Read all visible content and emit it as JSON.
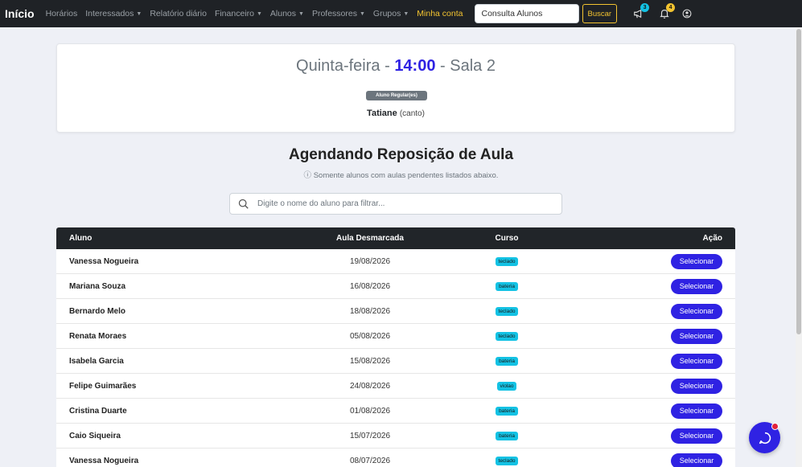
{
  "nav": {
    "brand": "Início",
    "items": [
      {
        "label": "Horários",
        "caret": false
      },
      {
        "label": "Interessados",
        "caret": true
      },
      {
        "label": "Relatório diário",
        "caret": false
      },
      {
        "label": "Financeiro",
        "caret": true
      },
      {
        "label": "Alunos",
        "caret": true
      },
      {
        "label": "Professores",
        "caret": true
      },
      {
        "label": "Grupos",
        "caret": true
      },
      {
        "label": "Minha conta",
        "caret": false,
        "active": true
      }
    ],
    "search_value": "Consulta Alunos",
    "search_button": "Buscar",
    "megaphone_count": "3",
    "bell_count": "4"
  },
  "class_info": {
    "day": "Quinta-feira",
    "sep1": " - ",
    "time": "14:00",
    "sep2": " - ",
    "room": "Sala 2",
    "badge": "Aluno Regular(es)",
    "student": "Tatiane",
    "student_note": "(canto)"
  },
  "page": {
    "heading": "Agendando Reposição de Aula",
    "note": "Somente alunos com aulas pendentes listados abaixo.",
    "filter_placeholder": "Digite o nome do aluno para filtrar..."
  },
  "table": {
    "headers": [
      "Aluno",
      "Aula Desmarcada",
      "Curso",
      "Ação"
    ],
    "rows": [
      {
        "aluno": "Vanessa Nogueira",
        "data": "19/08/2026",
        "curso": "teclado",
        "acao": "Selecionar"
      },
      {
        "aluno": "Mariana Souza",
        "data": "16/08/2026",
        "curso": "bateria",
        "acao": "Selecionar"
      },
      {
        "aluno": "Bernardo Melo",
        "data": "18/08/2026",
        "curso": "teclado",
        "acao": "Selecionar"
      },
      {
        "aluno": "Renata Moraes",
        "data": "05/08/2026",
        "curso": "teclado",
        "acao": "Selecionar"
      },
      {
        "aluno": "Isabela Garcia",
        "data": "15/08/2026",
        "curso": "bateria",
        "acao": "Selecionar"
      },
      {
        "aluno": "Felipe Guimarães",
        "data": "24/08/2026",
        "curso": "violao",
        "acao": "Selecionar"
      },
      {
        "aluno": "Cristina Duarte",
        "data": "01/08/2026",
        "curso": "bateria",
        "acao": "Selecionar"
      },
      {
        "aluno": "Caio Siqueira",
        "data": "15/07/2026",
        "curso": "bateria",
        "acao": "Selecionar"
      },
      {
        "aluno": "Vanessa Nogueira",
        "data": "08/07/2026",
        "curso": "teclado",
        "acao": "Selecionar"
      }
    ]
  },
  "colors": {
    "accent": "#2f22e3",
    "navbar": "#1f2226",
    "nav_active": "#f4c430",
    "course_badge": "#13c2e4",
    "megaphone_badge": "#13c2e4",
    "bell_badge": "#f4c430",
    "chat_dot": "#e2223a"
  },
  "icons": {
    "megaphone": "megaphone-icon",
    "bell": "bell-icon",
    "user": "user-circle-icon",
    "search": "search-icon",
    "info": "info-icon",
    "chat": "chat-icon"
  }
}
